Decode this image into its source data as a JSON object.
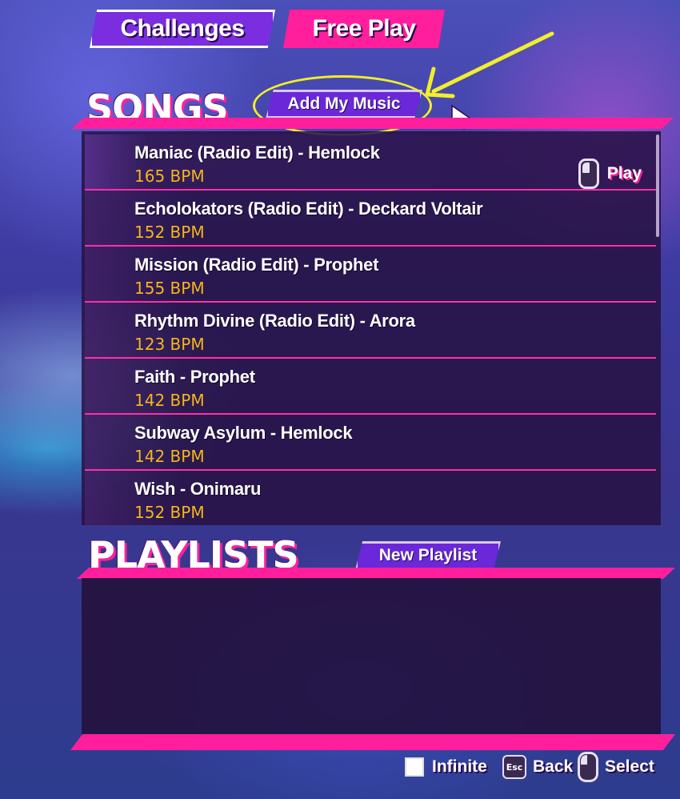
{
  "tabs": {
    "challenges_label": "Challenges",
    "free_play_label": "Free Play",
    "active": "Free Play"
  },
  "songs_section": {
    "title": "SONGS",
    "add_button": "Add My Music",
    "items": [
      {
        "title": "Maniac (Radio Edit) - Hemlock",
        "bpm": "165 BPM",
        "selected": true,
        "hint_label": "Play"
      },
      {
        "title": "Echolokators (Radio Edit) - Deckard Voltair",
        "bpm": "152 BPM"
      },
      {
        "title": "Mission (Radio Edit) - Prophet",
        "bpm": "155 BPM"
      },
      {
        "title": "Rhythm Divine (Radio Edit) - Arora",
        "bpm": "123 BPM"
      },
      {
        "title": "Faith - Prophet",
        "bpm": "142 BPM"
      },
      {
        "title": "Subway Asylum - Hemlock",
        "bpm": "142 BPM"
      },
      {
        "title": "Wish - Onimaru",
        "bpm": "152 BPM"
      }
    ]
  },
  "playlists_section": {
    "title": "PLAYLISTS",
    "new_button": "New Playlist"
  },
  "footer": {
    "infinite_label": "Infinite",
    "esc_key": "Esc",
    "back_label": "Back",
    "select_label": "Select"
  },
  "colors": {
    "accent_pink": "#ff1f9c",
    "accent_purple": "#6a28d8",
    "bpm_yellow": "#f4b51c",
    "annotation_yellow": "#f1ee2a"
  },
  "icons": [
    "mouse-left-click-icon",
    "cursor-icon",
    "esc-key-icon",
    "checkbox-icon",
    "annotation-arrow-icon"
  ]
}
